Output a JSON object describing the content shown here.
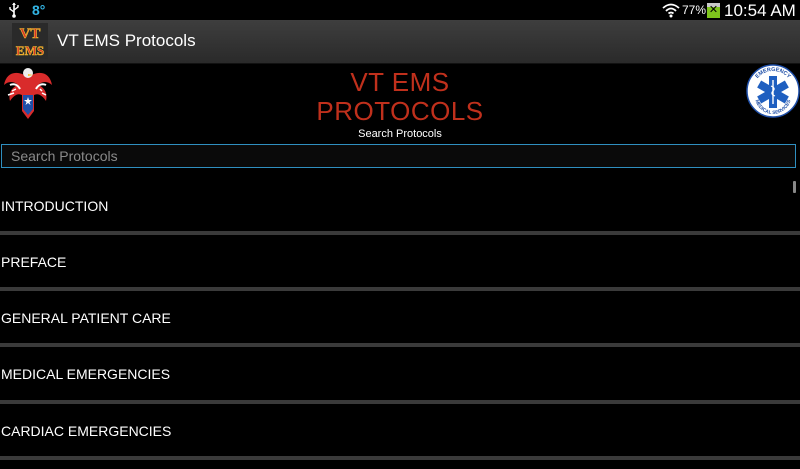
{
  "status_bar": {
    "temperature": "8°",
    "battery_percent": "77%",
    "time": "10:54 AM"
  },
  "action_bar": {
    "app_title": "VT EMS Protocols",
    "logo_text": "VT EMS"
  },
  "header": {
    "title_line1": "VT EMS",
    "title_line2": "PROTOCOLS",
    "search_label": "Search Protocols",
    "badge_text": "EMERGENCY MEDICAL SERVICES"
  },
  "search": {
    "placeholder": "Search Protocols",
    "value": ""
  },
  "protocols": [
    {
      "label": "INTRODUCTION"
    },
    {
      "label": "PREFACE"
    },
    {
      "label": "GENERAL PATIENT CARE"
    },
    {
      "label": "MEDICAL EMERGENCIES"
    },
    {
      "label": "CARDIAC EMERGENCIES"
    }
  ],
  "colors": {
    "accent": "#33b5e5",
    "title_red": "#c0301c",
    "background": "#000000"
  }
}
